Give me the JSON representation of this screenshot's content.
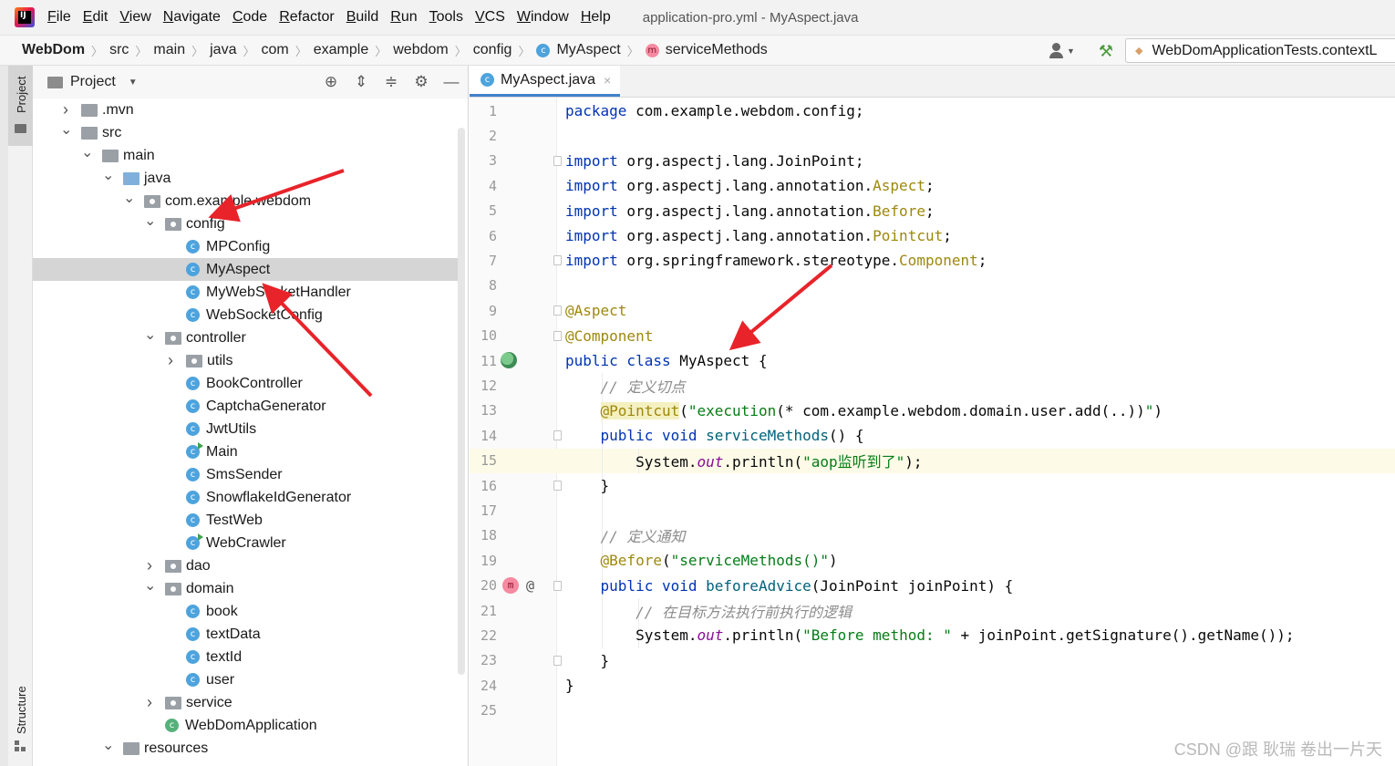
{
  "menubar": {
    "items": [
      "File",
      "Edit",
      "View",
      "Navigate",
      "Code",
      "Refactor",
      "Build",
      "Run",
      "Tools",
      "VCS",
      "Window",
      "Help"
    ],
    "window_title": "application-pro.yml - MyAspect.java",
    "logo_text": "IJ"
  },
  "breadcrumb": {
    "items": [
      "WebDom",
      "src",
      "main",
      "java",
      "com",
      "example",
      "webdom",
      "config",
      "MyAspect",
      "serviceMethods"
    ],
    "class_badge": "c",
    "method_badge": "m"
  },
  "toolbar": {
    "run_config": "WebDomApplicationTests.contextL",
    "user_icon": "user-dropdown-icon",
    "build_icon": "hammer-icon"
  },
  "stripe": {
    "project_label": "Project",
    "structure_label": "Structure"
  },
  "project_panel": {
    "title": "Project",
    "tools": [
      "locate-icon",
      "expand-all-icon",
      "collapse-all-icon",
      "gear-icon",
      "hide-icon"
    ],
    "tree": [
      {
        "label": ".mvn",
        "indent": 0,
        "arrow": "right",
        "icon": "folder"
      },
      {
        "label": "src",
        "indent": 0,
        "arrow": "down",
        "icon": "folder"
      },
      {
        "label": "main",
        "indent": 1,
        "arrow": "down",
        "icon": "folder"
      },
      {
        "label": "java",
        "indent": 2,
        "arrow": "down",
        "icon": "folder-blue"
      },
      {
        "label": "com.example.webdom",
        "indent": 3,
        "arrow": "down",
        "icon": "package"
      },
      {
        "label": "config",
        "indent": 4,
        "arrow": "down",
        "icon": "package"
      },
      {
        "label": "MPConfig",
        "indent": 5,
        "arrow": "none",
        "icon": "class"
      },
      {
        "label": "MyAspect",
        "indent": 5,
        "arrow": "none",
        "icon": "class",
        "selected": true
      },
      {
        "label": "MyWebSocketHandler",
        "indent": 5,
        "arrow": "none",
        "icon": "class"
      },
      {
        "label": "WebSocketConfig",
        "indent": 5,
        "arrow": "none",
        "icon": "class"
      },
      {
        "label": "controller",
        "indent": 4,
        "arrow": "down",
        "icon": "package"
      },
      {
        "label": "utils",
        "indent": 5,
        "arrow": "right",
        "icon": "package"
      },
      {
        "label": "BookController",
        "indent": 5,
        "arrow": "none",
        "icon": "class"
      },
      {
        "label": "CaptchaGenerator",
        "indent": 5,
        "arrow": "none",
        "icon": "class"
      },
      {
        "label": "JwtUtils",
        "indent": 5,
        "arrow": "none",
        "icon": "class"
      },
      {
        "label": "Main",
        "indent": 5,
        "arrow": "none",
        "icon": "class-runnable"
      },
      {
        "label": "SmsSender",
        "indent": 5,
        "arrow": "none",
        "icon": "class"
      },
      {
        "label": "SnowflakeIdGenerator",
        "indent": 5,
        "arrow": "none",
        "icon": "class"
      },
      {
        "label": "TestWeb",
        "indent": 5,
        "arrow": "none",
        "icon": "class"
      },
      {
        "label": "WebCrawler",
        "indent": 5,
        "arrow": "none",
        "icon": "class-runnable"
      },
      {
        "label": "dao",
        "indent": 4,
        "arrow": "right",
        "icon": "package"
      },
      {
        "label": "domain",
        "indent": 4,
        "arrow": "down",
        "icon": "package"
      },
      {
        "label": "book",
        "indent": 5,
        "arrow": "none",
        "icon": "class"
      },
      {
        "label": "textData",
        "indent": 5,
        "arrow": "none",
        "icon": "class"
      },
      {
        "label": "textId",
        "indent": 5,
        "arrow": "none",
        "icon": "class"
      },
      {
        "label": "user",
        "indent": 5,
        "arrow": "none",
        "icon": "class"
      },
      {
        "label": "service",
        "indent": 4,
        "arrow": "right",
        "icon": "package"
      },
      {
        "label": "WebDomApplication",
        "indent": 4,
        "arrow": "none",
        "icon": "class-spring"
      },
      {
        "label": "resources",
        "indent": 2,
        "arrow": "down",
        "icon": "folder"
      }
    ]
  },
  "editor": {
    "tab_label": "MyAspect.java",
    "tab_close": "×",
    "current_line": 15,
    "lines": [
      {
        "n": "1",
        "tokens": [
          [
            "kw",
            "package"
          ],
          [
            "pk",
            " com.example.webdom.config;"
          ]
        ]
      },
      {
        "n": "2",
        "tokens": []
      },
      {
        "n": "3",
        "tokens": [
          [
            "kw",
            "import"
          ],
          [
            "pk",
            " org.aspectj.lang.JoinPoint;"
          ]
        ],
        "fold": true
      },
      {
        "n": "4",
        "tokens": [
          [
            "kw",
            "import"
          ],
          [
            "pk",
            " org.aspectj.lang.annotation."
          ],
          [
            "an",
            "Aspect"
          ],
          [
            "pk",
            ";"
          ]
        ]
      },
      {
        "n": "5",
        "tokens": [
          [
            "kw",
            "import"
          ],
          [
            "pk",
            " org.aspectj.lang.annotation."
          ],
          [
            "an",
            "Before"
          ],
          [
            "pk",
            ";"
          ]
        ]
      },
      {
        "n": "6",
        "tokens": [
          [
            "kw",
            "import"
          ],
          [
            "pk",
            " org.aspectj.lang.annotation."
          ],
          [
            "an",
            "Pointcut"
          ],
          [
            "pk",
            ";"
          ]
        ]
      },
      {
        "n": "7",
        "tokens": [
          [
            "kw",
            "import"
          ],
          [
            "pk",
            " org.springframework.stereotype."
          ],
          [
            "an",
            "Component"
          ],
          [
            "pk",
            ";"
          ]
        ],
        "fold": true
      },
      {
        "n": "8",
        "tokens": []
      },
      {
        "n": "9",
        "tokens": [
          [
            "an",
            "@Aspect"
          ]
        ],
        "fold": true
      },
      {
        "n": "10",
        "tokens": [
          [
            "an",
            "@Component"
          ]
        ],
        "fold": true
      },
      {
        "n": "11",
        "tokens": [
          [
            "kw",
            "public class"
          ],
          [
            "pk",
            " MyAspect {"
          ]
        ],
        "gicon": "spring"
      },
      {
        "n": "12",
        "tokens": [
          [
            "pk",
            "    "
          ],
          [
            "cm",
            "// 定义切点"
          ]
        ]
      },
      {
        "n": "13",
        "tokens": [
          [
            "pk",
            "    "
          ],
          [
            "anhl",
            "@Pointcut"
          ],
          [
            "pk",
            "("
          ],
          [
            "str",
            "\"execution"
          ],
          [
            "pk",
            "(* com.example.webdom.domain.user.add(..))"
          ],
          [
            "str",
            "\""
          ],
          [
            "pk",
            ")"
          ]
        ]
      },
      {
        "n": "14",
        "tokens": [
          [
            "pk",
            "    "
          ],
          [
            "kw",
            "public void"
          ],
          [
            "pk",
            " "
          ],
          [
            "fn",
            "serviceMethods"
          ],
          [
            "pk",
            "() {"
          ]
        ],
        "fold": true
      },
      {
        "n": "15",
        "tokens": [
          [
            "pk",
            "        System."
          ],
          [
            "fld",
            "out"
          ],
          [
            "pk",
            ".println("
          ],
          [
            "str",
            "\"aop监听到了\""
          ],
          [
            "pk",
            ");"
          ]
        ]
      },
      {
        "n": "16",
        "tokens": [
          [
            "pk",
            "    }"
          ]
        ],
        "fold": true
      },
      {
        "n": "17",
        "tokens": []
      },
      {
        "n": "18",
        "tokens": [
          [
            "pk",
            "    "
          ],
          [
            "cm",
            "// 定义通知"
          ]
        ]
      },
      {
        "n": "19",
        "tokens": [
          [
            "pk",
            "    "
          ],
          [
            "an",
            "@Before"
          ],
          [
            "pk",
            "("
          ],
          [
            "str",
            "\"serviceMethods()\""
          ],
          [
            "pk",
            ")"
          ]
        ]
      },
      {
        "n": "20",
        "tokens": [
          [
            "pk",
            "    "
          ],
          [
            "kw",
            "public void"
          ],
          [
            "pk",
            " "
          ],
          [
            "fn",
            "beforeAdvice"
          ],
          [
            "pk",
            "(JoinPoint joinPoint) {"
          ]
        ],
        "fold": true,
        "gicon": "advice"
      },
      {
        "n": "21",
        "tokens": [
          [
            "pk",
            "        "
          ],
          [
            "cm",
            "// 在目标方法执行前执行的逻辑"
          ]
        ]
      },
      {
        "n": "22",
        "tokens": [
          [
            "pk",
            "        System."
          ],
          [
            "fld",
            "out"
          ],
          [
            "pk",
            ".println("
          ],
          [
            "str",
            "\"Before method: \""
          ],
          [
            "pk",
            " + joinPoint.getSignature().getName());"
          ]
        ]
      },
      {
        "n": "23",
        "tokens": [
          [
            "pk",
            "    }"
          ]
        ],
        "fold": true
      },
      {
        "n": "24",
        "tokens": [
          [
            "pk",
            "}"
          ]
        ]
      },
      {
        "n": "25",
        "tokens": []
      }
    ]
  },
  "watermark": "CSDN @跟 耿瑞 卷出一片天",
  "colors": {
    "keyword": "#0033b3",
    "annotation": "#9e880d",
    "string": "#067d17",
    "comment": "#8c8c8c",
    "field": "#871094",
    "method": "#00627a",
    "arrow": "#e8232a",
    "selection": "#d5d5d5"
  }
}
